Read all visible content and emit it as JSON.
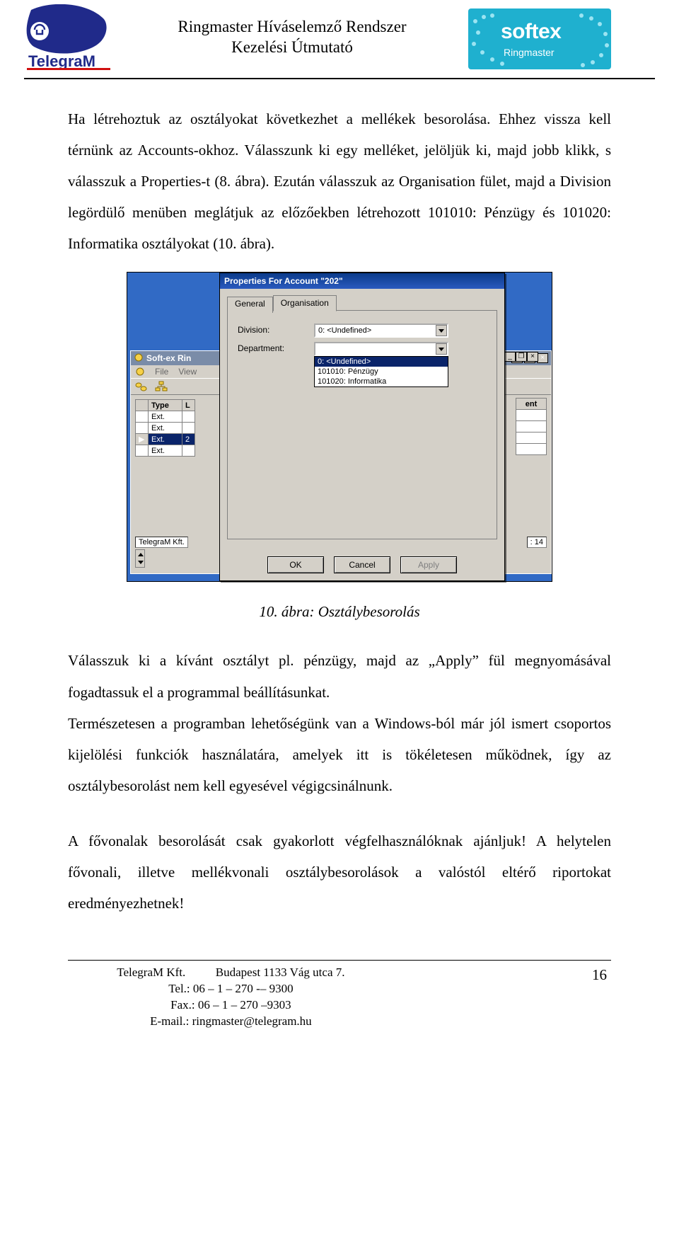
{
  "header": {
    "title_line1": "Ringmaster Híváselemző Rendszer",
    "title_line2": "Kezelési Útmutató",
    "logo_telegram_text": "TelegraM",
    "logo_softex_text": "softex",
    "logo_softex_sub": "Ringmaster"
  },
  "para1": "Ha létrehoztuk az osztályokat következhet a mellékek besorolása. Ehhez vissza kell térnünk az Accounts-okhoz. Válasszunk ki egy melléket, jelöljük ki, majd jobb klikk, s válasszuk a Properties-t (8. ábra). Ezután válasszuk az Organisation fület, majd a Division legördülő menüben meglátjuk az előzőekben létrehozott 101010: Pénzügy és 101020: Informatika osztályokat (10. ábra).",
  "figure": {
    "bg": {
      "title": "Soft-ex Rin",
      "menu": {
        "file": "File",
        "view": "View"
      },
      "grid": {
        "headers": [
          "Type",
          "L"
        ],
        "rows": [
          "Ext.",
          "Ext.",
          "Ext.",
          "Ext."
        ],
        "selected_index": 2,
        "selected_extra": "2"
      },
      "right_header": "ent",
      "status_left": "TelegraM Kft.",
      "status_right": ": 14"
    },
    "dlg": {
      "title": "Properties For Account \"202\"",
      "tabs": {
        "general": "General",
        "organisation": "Organisation"
      },
      "labels": {
        "division": "Division:",
        "department": "Department:"
      },
      "division_value": "0: <Undefined>",
      "department_options": [
        "0: <Undefined>",
        "101010: Pénzügy",
        "101020: Informatika"
      ],
      "department_selected": 0,
      "buttons": {
        "ok": "OK",
        "cancel": "Cancel",
        "apply": "Apply"
      }
    }
  },
  "caption": "10. ábra: Osztálybesorolás",
  "para2": "Válasszuk ki a kívánt osztályt pl. pénzügy, majd az „Apply” fül megnyomásával fogadtassuk el a programmal beállításunkat.",
  "para3": "Természetesen a programban lehetőségünk van a Windows-ból már jól ismert csoportos kijelölési funkciók használatára, amelyek itt is tökéletesen működnek, így az osztálybesorolást nem kell egyesével végigcsinálnunk.",
  "para4": "A fővonalak besorolását csak gyakorlott végfelhasználóknak ajánljuk! A helytelen fővonali, illetve mellékvonali osztálybesorolások a valóstól eltérő riportokat eredményezhetnek!",
  "footer": {
    "line1": "TelegraM Kft.          Budapest 1133 Vág utca 7.",
    "line2": "Tel.: 06 – 1 – 270 -– 9300",
    "line3": "Fax.: 06 – 1 – 270 –9303",
    "line4": "E-mail.: ringmaster@telegram.hu",
    "page": "16"
  }
}
